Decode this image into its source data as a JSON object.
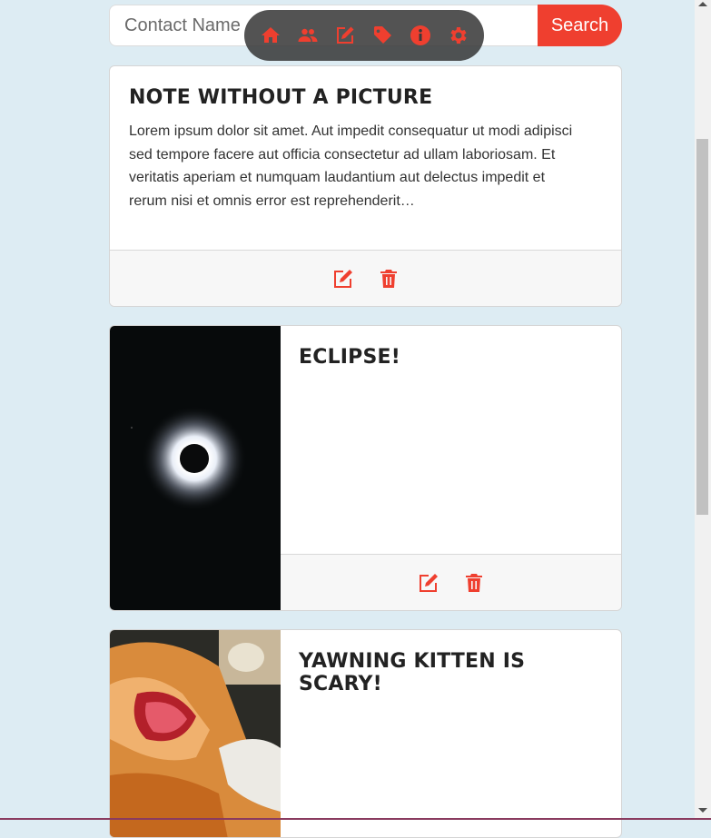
{
  "search": {
    "placeholder": "Contact Name",
    "button_label": "Search"
  },
  "toolbar": {
    "icons": [
      "home-icon",
      "contacts-icon",
      "edit-note-icon",
      "tag-icon",
      "info-icon",
      "settings-icon"
    ],
    "background": "#373737",
    "icon_color": "#ef3f2f"
  },
  "notes": [
    {
      "title": "NOTE WITHOUT A PICTURE",
      "body": "Lorem ipsum dolor sit amet. Aut impedit consequatur ut modi adipisci sed tempore facere aut officia consectetur ad ullam laboriosam. Et veritatis aperiam et numquam laudantium aut delectus impedit et rerum nisi et omnis error est reprehenderit…",
      "image": null
    },
    {
      "title": "ECLIPSE!",
      "body": "",
      "image": "eclipse-photo"
    },
    {
      "title": "YAWNING KITTEN IS SCARY!",
      "body": "",
      "image": "kitten-photo"
    }
  ],
  "footer_icons": [
    "edit-icon",
    "delete-icon"
  ],
  "colors": {
    "accent": "#ef3f2f",
    "page_background": "#ddecf3",
    "card_footer": "#f7f7f7"
  }
}
